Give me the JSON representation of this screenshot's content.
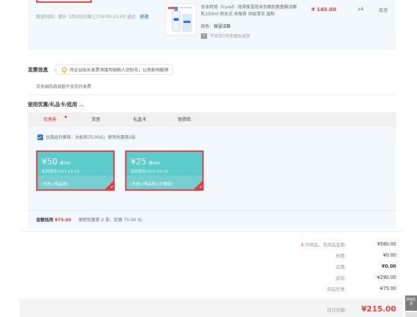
{
  "product": {
    "ship_time": "配送时间：预计 1月20日[周三] 09:00-21:00 送达",
    "ship_edit": "修改",
    "title": "日本珂润（Curel）润浸保湿泡沫洗面奶氨基酸洁面乳150ml 男女式 去角质 深层清洁 温和",
    "color_label": "颜色：",
    "color_value": "保湿洁面",
    "return_policy": "不支持7天无理由退货",
    "return_icon": "7",
    "price": "¥ 145.00",
    "qty": "x4",
    "stock": "有货"
  },
  "invoice": {
    "title": "发票信息",
    "tip": "开企业抬头发票须填写纳税人识别号，以免影响报销",
    "note": "京东国际商品暂不支持开发票"
  },
  "coupons": {
    "title": "使用优惠/礼品卡/抵用",
    "chevron": "︿",
    "tabs": [
      {
        "label": "优惠券"
      },
      {
        "label": "京豆"
      },
      {
        "label": "礼品卡"
      },
      {
        "label": "领货码"
      }
    ],
    "combo_text": "优惠组合推荐，共抵用75.00元；使用优惠券2张",
    "items": [
      {
        "amount": "¥50",
        "min": "满399",
        "expiry": "有效期至2021-01-15",
        "scope": "[东券] [限品类]"
      },
      {
        "amount": "¥25",
        "min": "满499",
        "expiry": "有效期至2021-01-15",
        "scope": "[东券] [限品类] [可叠加]"
      }
    ],
    "deduct_label": "金额抵用",
    "deduct_amount": "¥75.00",
    "deduct_detail": "使用优惠券 2 张，优惠 75.00 元"
  },
  "summary": {
    "count": "4",
    "count_suffix": "件商品，总商品金额:",
    "rows": [
      {
        "label": "税费:",
        "value": "¥0.00"
      },
      {
        "label": "运费:",
        "value": "¥0.00"
      },
      {
        "label": "返现:",
        "value": "-¥290.00"
      },
      {
        "label": "商品优惠:",
        "value": "-¥75.00"
      }
    ],
    "goods_total": "¥580.00",
    "total_label": "应付总额:",
    "total_value": "¥215.00"
  },
  "side": {
    "feedback": "我要反馈"
  },
  "colors": {
    "accent": "#e4393c",
    "coupon": "#5ccbcc",
    "link": "#005aa0"
  }
}
